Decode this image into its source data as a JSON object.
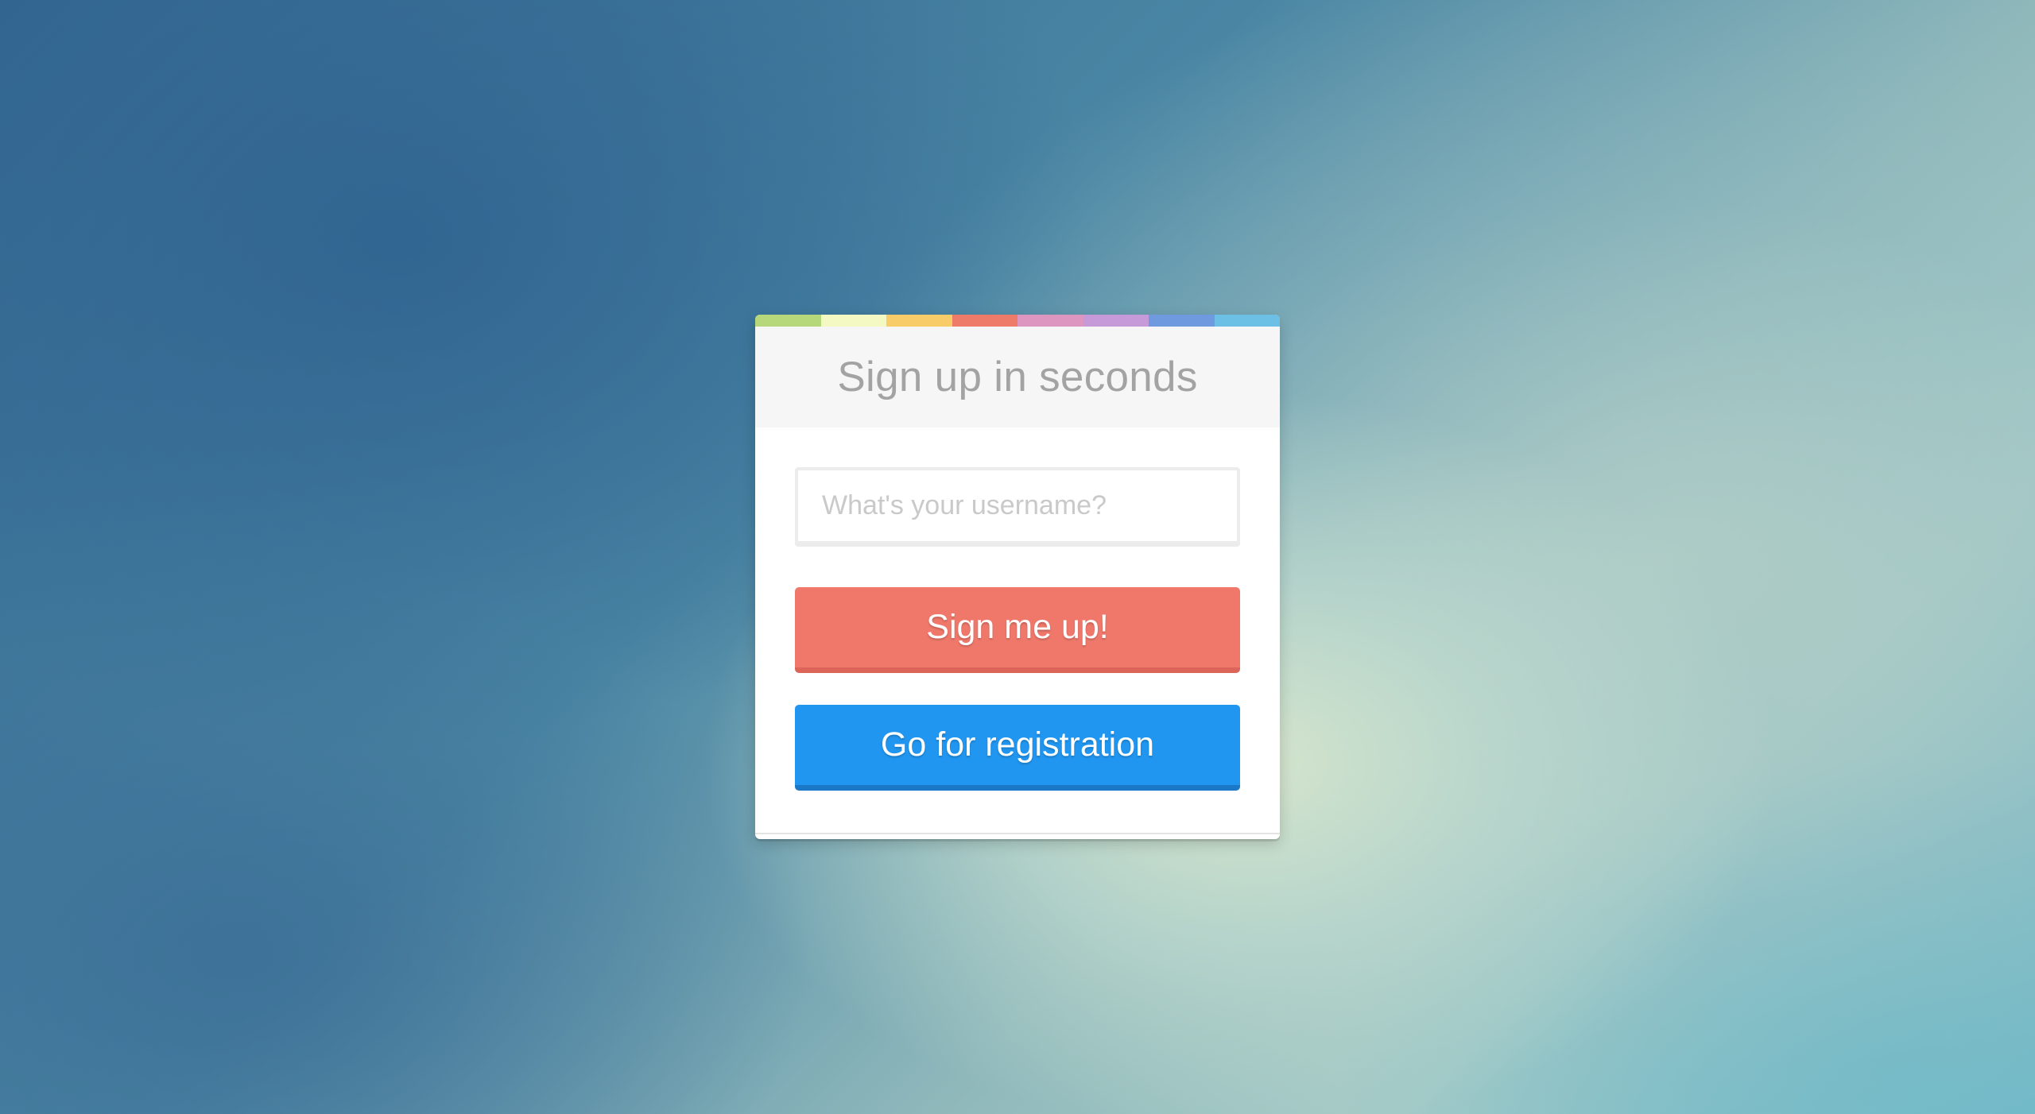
{
  "page": {
    "background_colors": [
      "#336791",
      "#a8ccc7",
      "#dbe8cc",
      "#78b9c6"
    ]
  },
  "card": {
    "color_strip": [
      "#b6d87a",
      "#f4f8c2",
      "#f8cd69",
      "#ee7a69",
      "#dd96c0",
      "#c69ad8",
      "#6f9ae0",
      "#6cc0e6"
    ],
    "title": "Sign up in seconds",
    "username_input": {
      "value": "",
      "placeholder": "What's your username?"
    },
    "signup_button": {
      "label": "Sign me up!",
      "color": "#ef786b"
    },
    "register_button": {
      "label": "Go for registration",
      "color": "#2196f0"
    }
  }
}
